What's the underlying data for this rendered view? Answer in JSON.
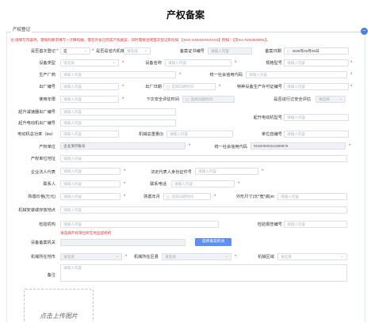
{
  "page_title": "产权备案",
  "section_legend": "产权登记",
  "collapse_symbol": "−",
  "notice": "注:请填写内容项，需按照要求填写 • 计算机械，需在外省已完成产权备案，同时需要注明首次登记年份如 【XXX-XXXXXXXXXXX】例如：【京XA-T202500001】。",
  "star": "*",
  "placeholders": {
    "select": "请选择",
    "input": "请输入内容",
    "date": "选择日期时间"
  },
  "fields": {
    "first_reg": {
      "label": "是否首次登记",
      "value": "是"
    },
    "province_machine": {
      "label": "是否是省内机械",
      "value": "请选择"
    },
    "cert_no": {
      "label": "备案证书编号",
      "placeholder": "请输入内容"
    },
    "record_date": {
      "label": "备案日期",
      "value": "2025年03月03日"
    },
    "equip_type": {
      "label": "设备类型"
    },
    "equip_name": {
      "label": "设备名称"
    },
    "spec_model": {
      "label": "规格型号"
    },
    "manufacturer": {
      "label": "生产厂商"
    },
    "credit_code": {
      "label": "统一社会信用代码"
    },
    "factory_no": {
      "label": "出厂编号"
    },
    "factory_date": {
      "label": "出厂日期"
    },
    "special_license": {
      "label": "特种设备生产许可证编号"
    },
    "service_years": {
      "label": "使用年限"
    },
    "next_eval": {
      "label": "下次安全评估时间"
    },
    "need_eval": {
      "label": "是否进行过安全评估",
      "value": "请选择"
    },
    "reducer_no": {
      "label": "起升减速器出厂编号"
    },
    "motor_model": {
      "label": "起升电动机型号"
    },
    "motor_no": {
      "label": "起升电动机出厂编号"
    },
    "motor_power": {
      "label": "电动机总功率（kw）"
    },
    "total_weight": {
      "label": "机械总重量(t)"
    },
    "unit_price": {
      "label": "单位自编号"
    },
    "owner_unit": {
      "label": "产权单位",
      "value": "企业演示账号"
    },
    "owner_credit": {
      "label": "统一社会信用代码",
      "value": "91620000224368875"
    },
    "owner_address": {
      "label": "产权单位地址"
    },
    "legal_rep": {
      "label": "企业法人代表"
    },
    "legal_id": {
      "label": "法定代表人身份证件号"
    },
    "contact": {
      "label": "联系人"
    },
    "contact_phone": {
      "label": "联系电话"
    },
    "purchase_price": {
      "label": "购置价格(万元)"
    },
    "purchase_date": {
      "label": "购置年月"
    },
    "dimension": {
      "label": "外形尺寸(长*宽*高)m"
    },
    "storage_addr": {
      "label": "机械安装或存放地点"
    },
    "inspect_org": {
      "label": "检验机构"
    },
    "inspect_report": {
      "label": "检验报告编号"
    },
    "record_org": {
      "label": "设备备案机关",
      "hint": "请选择产权单位所在地监督机构"
    },
    "choose_org_btn": "选择备案机关",
    "machine_city": {
      "label": "机械所在地市",
      "value": "请选择"
    },
    "machine_district": {
      "label": "机械所在区县",
      "value": "请选择"
    },
    "machine_area": {
      "label": "机械区域",
      "value": "请选择"
    },
    "remark": {
      "label": "备注"
    }
  },
  "upload_label": "点击上传图片",
  "icons": {
    "calendar": "▢",
    "chevron": "⌄"
  }
}
